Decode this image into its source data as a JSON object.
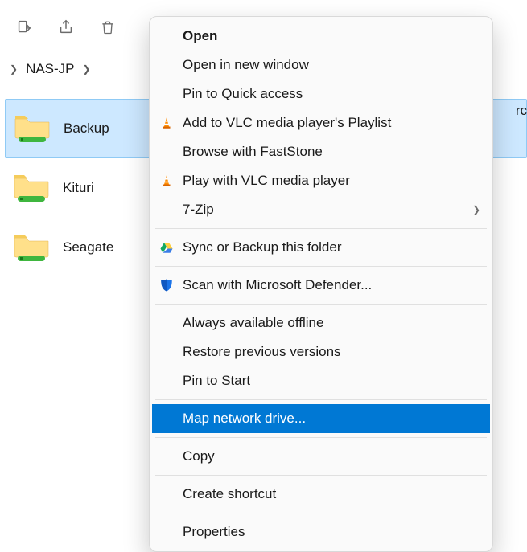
{
  "toolbar": {
    "cut_icon": "cut",
    "share_icon": "share",
    "trash_icon": "trash"
  },
  "breadcrumb": {
    "current": "NAS-JP"
  },
  "partial_right": "rc",
  "folders": [
    {
      "name": "Backup",
      "selected": true
    },
    {
      "name": "Kituri",
      "selected": false
    },
    {
      "name": "Seagate",
      "selected": false
    }
  ],
  "context_menu": {
    "groups": [
      [
        {
          "label": "Open",
          "bold": true,
          "icon": null,
          "submenu": false
        },
        {
          "label": "Open in new window",
          "bold": false,
          "icon": null,
          "submenu": false
        },
        {
          "label": "Pin to Quick access",
          "bold": false,
          "icon": null,
          "submenu": false
        },
        {
          "label": "Add to VLC media player's Playlist",
          "bold": false,
          "icon": "vlc",
          "submenu": false
        },
        {
          "label": "Browse with FastStone",
          "bold": false,
          "icon": null,
          "submenu": false
        },
        {
          "label": "Play with VLC media player",
          "bold": false,
          "icon": "vlc",
          "submenu": false
        },
        {
          "label": "7-Zip",
          "bold": false,
          "icon": null,
          "submenu": true
        }
      ],
      [
        {
          "label": "Sync or Backup this folder",
          "bold": false,
          "icon": "gdrive",
          "submenu": false
        }
      ],
      [
        {
          "label": "Scan with Microsoft Defender...",
          "bold": false,
          "icon": "defender",
          "submenu": false
        }
      ],
      [
        {
          "label": "Always available offline",
          "bold": false,
          "icon": null,
          "submenu": false
        },
        {
          "label": "Restore previous versions",
          "bold": false,
          "icon": null,
          "submenu": false
        },
        {
          "label": "Pin to Start",
          "bold": false,
          "icon": null,
          "submenu": false
        }
      ],
      [
        {
          "label": "Map network drive...",
          "bold": false,
          "icon": null,
          "submenu": false,
          "highlight": true
        }
      ],
      [
        {
          "label": "Copy",
          "bold": false,
          "icon": null,
          "submenu": false
        }
      ],
      [
        {
          "label": "Create shortcut",
          "bold": false,
          "icon": null,
          "submenu": false
        }
      ],
      [
        {
          "label": "Properties",
          "bold": false,
          "icon": null,
          "submenu": false
        }
      ]
    ]
  }
}
